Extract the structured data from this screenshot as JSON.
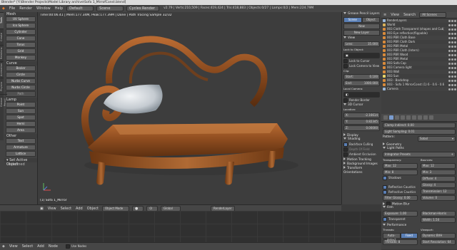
{
  "window": {
    "title": "Blender* [Y:\\Blender Projects\\Model Library archive\\Sofa 1_MirrofConst.blend]"
  },
  "infobar": {
    "menus": [
      "File",
      "Render",
      "Window",
      "Help"
    ],
    "layout": "Default",
    "scene": "Scene",
    "engine": "Cycles Render",
    "stats": "v2.79 | Verts:210,509 | Faces:419,424 | Tris:418,883 | Objects:0/27 | Lamps:0/2 | Mem:224.79M"
  },
  "toolshelf": {
    "tabs": [
      "Tools",
      "Create",
      "Relations",
      "Animation",
      "Physics",
      "Grease Pencil"
    ],
    "sections": [
      {
        "title": "Mesh",
        "items": [
          "UV Sphere",
          "Ico Sphere",
          "Cylinder",
          "Cone",
          "Torus",
          "Grid",
          "Monkey"
        ]
      },
      {
        "title": "Curve",
        "items": [
          "Bezier",
          "Circle",
          "Nurbs Curve",
          "Nurbs Circle",
          "Path"
        ]
      },
      {
        "title": "Lamp",
        "items": [
          "Point",
          "Sun",
          "Spot",
          "Hemi",
          "Area"
        ]
      },
      {
        "title": "Other",
        "items": [
          "Text",
          "Armature",
          "Lattice"
        ]
      }
    ],
    "add_object_label": "▾ Set Active Object",
    "undefined_label": "Undefined"
  },
  "viewport": {
    "info": "Time:00:06.41 | Mem:177.34M, Peak:177.39M | Done | Path Tracing Sample 32/32",
    "object_label": "(1) Sofa 1_Mirror",
    "footer": {
      "items": [
        "View",
        "Select",
        "Add",
        "Object"
      ],
      "mode": "Object Mode",
      "pivot": "Global",
      "layer": "RenderLayer"
    }
  },
  "npanel": {
    "grease_label": "Grease Pencil Layers",
    "scene_btn": "Scene",
    "object_btn": "Object",
    "new_btn": "New",
    "new_layer_btn": "New Layer",
    "view_label": "View",
    "lens_label": "Lens:",
    "lens_value": "35.000",
    "lock_label": "Lock to Object:",
    "lock_cursor": "Lock to Cursor",
    "lock_camera": "Lock Camera to View",
    "clip_label": "Clip:",
    "clip_start_label": "Start:",
    "clip_start": "0.100",
    "clip_end_label": "End:",
    "clip_end": "1000.000",
    "local_camera": "Local Camera:",
    "render_border": "Render Border",
    "cursor_label": "3D Cursor",
    "location_label": "Location:",
    "x_label": "X:",
    "x": "-2.16614",
    "y_label": "Y:",
    "y": "0.82345",
    "z_label": "Z:",
    "z": "0.00000",
    "display_label": "Display",
    "shading_label": "Shading",
    "backface": "Backface Culling",
    "depth_field": "Depth Of Field",
    "ambient": "Ambient Occlusion",
    "motion_tracking": "Motion Tracking",
    "background_images": "Background Images",
    "transform_orient": "Transform Orientations",
    "colors": {
      "accent": "#5a7fb5",
      "bg": "#3a3a3a"
    }
  },
  "outliner": {
    "view_label": "View",
    "search_label": "Search",
    "scenes_label": "All Scenes",
    "items": [
      {
        "name": "RenderLayers",
        "color": "#9ab7d9"
      },
      {
        "name": "World",
        "color": "#d9b15a"
      },
      {
        "name": "003 Cloth Transparent (shapes and Cub)",
        "color": "#d88a3a"
      },
      {
        "name": "003 Eye reflection(flippable)",
        "color": "#d88a3a"
      },
      {
        "name": "003 PBR Cloth Base",
        "color": "#d88a3a"
      },
      {
        "name": "003 PBR Cloth Dark",
        "color": "#d88a3a"
      },
      {
        "name": "003 PBR Metal",
        "color": "#d88a3a"
      },
      {
        "name": "003 PBR Cloth (Intern)",
        "color": "#d88a3a"
      },
      {
        "name": "003 PBR Wood",
        "color": "#d88a3a"
      },
      {
        "name": "003 PBR Metal",
        "color": "#d88a3a"
      },
      {
        "name": "003 Sofa Cap",
        "color": "#d88a3a"
      },
      {
        "name": "003 Camera light",
        "color": "#d88a3a"
      },
      {
        "name": "003 Wall",
        "color": "#d88a3a"
      },
      {
        "name": "003 Sun",
        "color": "#e6d36a"
      },
      {
        "name": "003 - Backdrop",
        "color": "#d88a3a"
      },
      {
        "name": "003 - Sofa 1 MirrorConst (1) 6 - 0.6 - 0.6",
        "color": "#d88a3a"
      },
      {
        "name": "Camera",
        "color": "#9ab7d9"
      }
    ]
  },
  "props": {
    "layer": "RenderLayer",
    "clamp_direct": "Clamp Indirect: 0.00",
    "light_sampling": "Light Sampling: 0.01",
    "pattern_label": "Pattern:",
    "pattern": "Sobol",
    "geometry": "Geometry",
    "light_paths": "Light Paths",
    "integrator_preset": "Integrator Presets",
    "transparency": "Transparency:",
    "bounces": "Bounces:",
    "t_max": "Max: 12",
    "t_min": "Min: 8",
    "b_max": "Max: 12",
    "b_min": "Min: 3",
    "shadows": "Shadows",
    "diffuse": "Diffuse: 4",
    "glossy": "Glossy: 4",
    "caustics_refl": "Reflective Caustics",
    "caustics_refr": "Refractive Caustics",
    "transmission": "Transmission: 12",
    "volume": "Volume: 0",
    "filter_glossy": "Filter Glossy: 0.00",
    "motion_blur": "Motion Blur",
    "film": "Film",
    "exposure": "Exposure: 1.00",
    "filter_type": "Blackman-Harris",
    "transparent": "Transparent",
    "width": "Width: 1.50",
    "performance": "Performance",
    "threads": "Threads:",
    "viewport": "Viewport:",
    "auto_detect": "Auto-detect",
    "fixed": "Fixed",
    "dynamic_bvh": "Dynamic BVH",
    "thread_count": "Threads: 8",
    "start_resolution": "Start Resolution: 64"
  },
  "bottom": {
    "items": [
      "View",
      "Select",
      "Add",
      "Node"
    ],
    "use_nodes": "Use Nodes"
  }
}
